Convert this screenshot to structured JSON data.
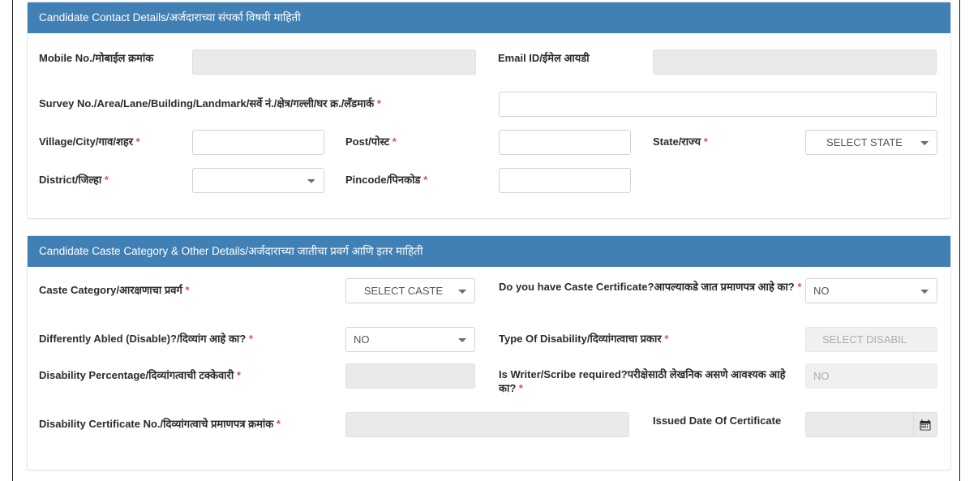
{
  "sections": [
    {
      "id": "contact",
      "title": "Candidate Contact Details/अर्जदाराच्या संपर्का विषयी माहिती",
      "fields": {
        "mobile": {
          "label": "Mobile No./मोबाईल क्रमांक",
          "value": "",
          "placeholder": "",
          "state": "disabled",
          "type": "text"
        },
        "email": {
          "label": "Email ID/ईमेल आयडी",
          "value": "",
          "placeholder": "",
          "state": "disabled",
          "type": "text"
        },
        "survey": {
          "label": "Survey No./Area/Lane/Building/Landmark/सर्वे नं./क्षेत्र/गल्ली/घर क्र./लँडमार्क",
          "required": "*",
          "value": "",
          "placeholder": "",
          "state": "enabled",
          "type": "text"
        },
        "village": {
          "label": "Village/City/गाव/शहर",
          "required": "*",
          "value": "",
          "placeholder": "",
          "state": "enabled",
          "type": "text"
        },
        "post": {
          "label": "Post/पोस्ट",
          "required": "*",
          "value": "",
          "placeholder": "",
          "state": "enabled",
          "type": "text"
        },
        "state": {
          "label": "State/राज्य",
          "required": "*",
          "value": "SELECT STATE",
          "state": "enabled",
          "type": "select"
        },
        "district": {
          "label": "District/जिल्हा",
          "required": "*",
          "value": "",
          "state": "enabled",
          "type": "select"
        },
        "pincode": {
          "label": "Pincode/पिनकोड",
          "required": "*",
          "value": "",
          "placeholder": "",
          "state": "enabled",
          "type": "text"
        }
      }
    },
    {
      "id": "caste",
      "title": "Candidate Caste Category & Other Details/अर्जदाराच्या जातीचा प्रवर्ग आणि इतर माहिती",
      "fields": {
        "caste_category": {
          "label": "Caste Category/आरक्षणाचा प्रवर्ग",
          "required": "*",
          "value": "SELECT CASTE",
          "state": "enabled",
          "type": "select"
        },
        "caste_cert": {
          "label": "Do you have Caste Certificate?आपल्याकडे जात प्रमाणपत्र आहे का?",
          "required": "*",
          "value": "NO",
          "state": "enabled",
          "type": "select"
        },
        "differently_abled": {
          "label": "Differently Abled (Disable)?/दिव्यांग आहे का?",
          "required": "*",
          "value": "NO",
          "state": "enabled",
          "type": "select"
        },
        "disability_type": {
          "label": "Type Of Disability/दिव्यांगत्वाचा प्रकार",
          "required": "*",
          "value": "SELECT DISABIL",
          "state": "disabled",
          "type": "select"
        },
        "disability_pct": {
          "label": "Disability Percentage/दिव्यांगत्वाची टक्केवारी",
          "required": "*",
          "value": "",
          "placeholder": "",
          "state": "disabled",
          "type": "text"
        },
        "writer_required": {
          "label": "Is Writer/Scribe required?परीक्षेसाठी लेखनिक असणे आवश्यक आहे का?",
          "required": "*",
          "value": "NO",
          "state": "disabled",
          "type": "select"
        },
        "disability_cert": {
          "label": "Disability Certificate No./दिव्यांगत्वाचे प्रमाणपत्र क्रमांक",
          "required": "*",
          "value": "",
          "placeholder": "",
          "state": "disabled",
          "type": "text"
        },
        "issued_date": {
          "label": "Issued Date Of Certificate",
          "value": "",
          "placeholder": "",
          "state": "disabled",
          "type": "date",
          "icon": "calendar-icon"
        }
      }
    }
  ],
  "colors": {
    "header_blue": "#4180b5",
    "required_red": "#d9534f",
    "disabled_bg": "#eaeaea",
    "border": "#d3d3d3"
  }
}
